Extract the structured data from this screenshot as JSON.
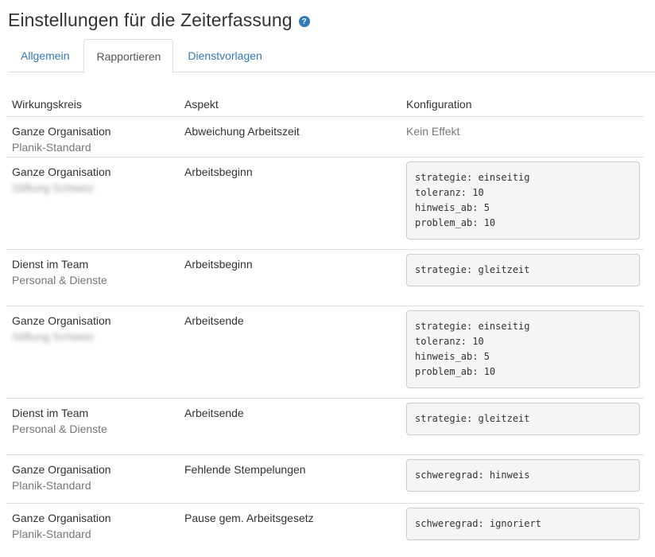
{
  "page": {
    "title": "Einstellungen für die Zeiterfassung",
    "help_icon": "?"
  },
  "tabs": [
    {
      "label": "Allgemein",
      "active": false
    },
    {
      "label": "Rapportieren",
      "active": true
    },
    {
      "label": "Dienstvorlagen",
      "active": false
    }
  ],
  "table": {
    "headers": [
      "Wirkungskreis",
      "Aspekt",
      "Konfiguration"
    ],
    "rows": [
      {
        "scope": "Ganze Organisation",
        "scope_sub": "Planik-Standard",
        "aspect": "Abweichung Arbeitszeit",
        "config": "Kein Effekt"
      },
      {
        "scope": "Ganze Organisation",
        "scope_sub": "Stiftung Schweiz",
        "aspect": "Arbeitsbeginn",
        "config": "strategie: einseitig\ntoleranz: 10\nhinweis_ab: 5\nproblem_ab: 10"
      },
      {
        "scope": "Dienst im Team",
        "scope_sub": "Personal & Dienste",
        "aspect": "Arbeitsbeginn",
        "config": "strategie: gleitzeit"
      },
      {
        "scope": "Ganze Organisation",
        "scope_sub": "Stiftung Schweiz",
        "aspect": "Arbeitsende",
        "config": "strategie: einseitig\ntoleranz: 10\nhinweis_ab: 5\nproblem_ab: 10"
      },
      {
        "scope": "Dienst im Team",
        "scope_sub": "Personal & Dienste",
        "aspect": "Arbeitsende",
        "config": "strategie: gleitzeit"
      },
      {
        "scope": "Ganze Organisation",
        "scope_sub": "Planik-Standard",
        "aspect": "Fehlende Stempelungen",
        "config": "schweregrad: hinweis"
      },
      {
        "scope": "Ganze Organisation",
        "scope_sub": "Planik-Standard",
        "aspect": "Pause gem. Arbeitsgesetz",
        "config": "schweregrad: ignoriert"
      }
    ]
  },
  "colors": {
    "link": "#337ab7",
    "muted": "#777777",
    "border": "#dddddd",
    "code_bg": "#f5f5f5"
  }
}
